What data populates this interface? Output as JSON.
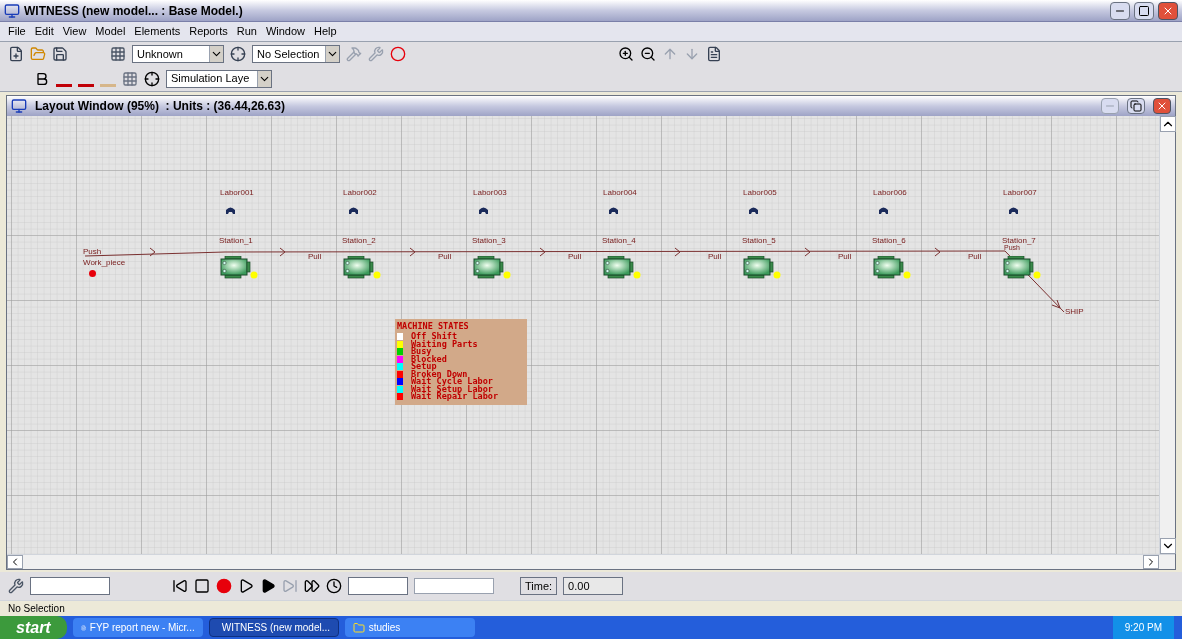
{
  "window": {
    "title": "WITNESS (new model... : Base Model.)"
  },
  "menu": [
    "File",
    "Edit",
    "View",
    "Model",
    "Elements",
    "Reports",
    "Run",
    "Window",
    "Help"
  ],
  "toolbar": {
    "element_type": "Unknown",
    "selection": "No Selection",
    "layer": "Simulation Laye"
  },
  "layout_window": {
    "title": "Layout Window (95%)  : Units : (36.44,26.63)"
  },
  "model": {
    "entry": {
      "rule": "Push",
      "name": "Work_piece"
    },
    "stations": [
      {
        "labor": "Labor001",
        "name": "Station_1"
      },
      {
        "labor": "Labor002",
        "name": "Station_2",
        "input_rule": "Pull"
      },
      {
        "labor": "Labor003",
        "name": "Station_3",
        "input_rule": "Pull"
      },
      {
        "labor": "Labor004",
        "name": "Station_4",
        "input_rule": "Pull"
      },
      {
        "labor": "Labor005",
        "name": "Station_5",
        "input_rule": "Pull"
      },
      {
        "labor": "Labor006",
        "name": "Station_6",
        "input_rule": "Pull"
      },
      {
        "labor": "Labor007",
        "name": "Station_7",
        "input_rule": "Pull",
        "output_rule": "Push"
      }
    ],
    "exit": "SHIP",
    "legend": {
      "title": "MACHINE STATES",
      "states": [
        {
          "label": "Off Shift",
          "color": "#ffffff"
        },
        {
          "label": "Waiting Parts",
          "color": "#ffff00"
        },
        {
          "label": "Busy",
          "color": "#00d000"
        },
        {
          "label": "Blocked",
          "color": "#ff00ff"
        },
        {
          "label": "Setup",
          "color": "#00ffff"
        },
        {
          "label": "Broken Down",
          "color": "#ff0000"
        },
        {
          "label": "Wait Cycle Labor",
          "color": "#0000ff"
        },
        {
          "label": "Wait Setup Labor",
          "color": "#00ffff"
        },
        {
          "label": "Wait Repair Labor",
          "color": "#ff0000"
        }
      ]
    }
  },
  "run_toolbar": {
    "time_label": "Time:",
    "time_value": "0.00"
  },
  "status_bar": "No Selection",
  "taskbar": {
    "start": "start",
    "tasks": [
      {
        "label": "FYP report new - Micr...",
        "selected": false
      },
      {
        "label": "WITNESS (new model...",
        "selected": true
      },
      {
        "label": "studies",
        "selected": false
      }
    ],
    "clock": "9:20 PM"
  }
}
